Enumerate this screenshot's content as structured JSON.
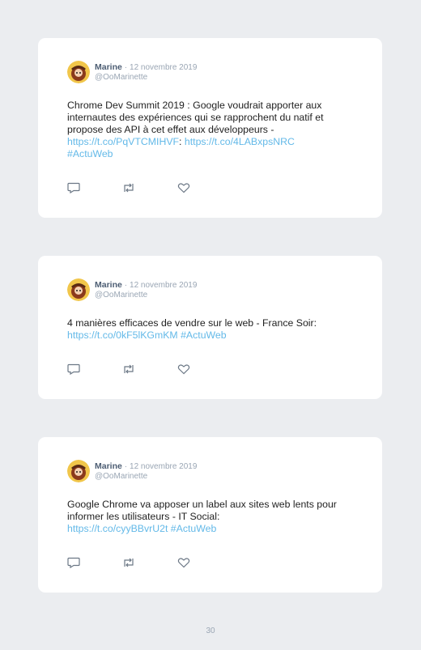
{
  "tweets": [
    {
      "author": {
        "name": "Marine",
        "handle": "@OoMarinette"
      },
      "separator": "·",
      "date": "12 novembre 2019",
      "text_parts": [
        "Chrome Dev Summit 2019 : Google voudrait apporter aux internautes des expériences qui se rapprochent du natif et propose des API à cet effet aux développeurs -\n",
        "https://t.co/PqVTCMIHVF",
        ": ",
        "https://t.co/4LABxpsNRC",
        "\n",
        "#ActuWeb"
      ]
    },
    {
      "author": {
        "name": "Marine",
        "handle": "@OoMarinette"
      },
      "separator": "·",
      "date": "12 novembre 2019",
      "text_parts": [
        "4 manières efficaces de vendre sur le web - France Soir:\n",
        "https://t.co/0kF5lKGmKM",
        " ",
        "#ActuWeb"
      ]
    },
    {
      "author": {
        "name": "Marine",
        "handle": "@OoMarinette"
      },
      "separator": "·",
      "date": "12 novembre 2019",
      "text_parts": [
        "Google Chrome va apposer un label aux sites web lents pour informer les utilisateurs - IT Social:\n",
        "https://t.co/cyyBBvrU2t",
        " ",
        "#ActuWeb"
      ]
    }
  ],
  "icons": {
    "reply": "reply-icon",
    "retweet": "retweet-icon",
    "like": "like-icon"
  },
  "colors": {
    "background": "#ebedf0",
    "card": "#ffffff",
    "link": "#63b9e8",
    "name": "#4c5d73",
    "muted": "#9aa6b4"
  },
  "page_number": "30"
}
